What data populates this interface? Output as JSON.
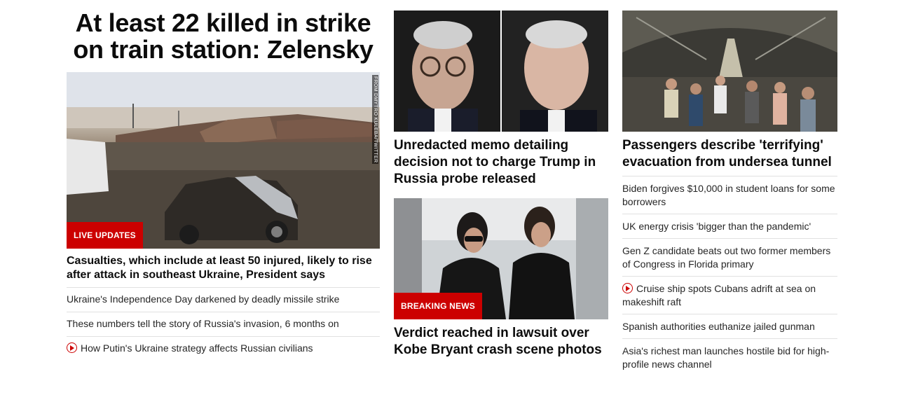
{
  "hero": {
    "title": "At least 22 killed in strike on train station: Zelensky",
    "photo_credit": "FROM DMYTRO KULEBA/TWITTER",
    "badge": "LIVE UPDATES",
    "caption": "Casualties, which include at least 50 injured, likely to rise after attack in southeast Ukraine, President says",
    "links": [
      {
        "text": "Ukraine's Independence Day darkened by deadly missile strike",
        "icon": "none"
      },
      {
        "text": "These numbers tell the story of Russia's invasion, 6 months on",
        "icon": "none"
      },
      {
        "text": "How Putin's Ukraine strategy affects Russian civilians",
        "icon": "play-icon"
      }
    ]
  },
  "middle": {
    "card1": {
      "title": "Unredacted memo detailing decision not to charge Trump in Russia probe released"
    },
    "card2": {
      "badge": "BREAKING NEWS",
      "title": "Verdict reached in lawsuit over Kobe Bryant crash scene photos"
    }
  },
  "right": {
    "card": {
      "title": "Passengers describe 'terrifying' evacuation from undersea tunnel"
    },
    "links": [
      {
        "text": "Biden forgives $10,000 in student loans for some borrowers",
        "icon": "none"
      },
      {
        "text": "UK energy crisis 'bigger than the pandemic'",
        "icon": "none"
      },
      {
        "text": "Gen Z candidate beats out two former members of Congress in Florida primary",
        "icon": "none"
      },
      {
        "text": "Cruise ship spots Cubans adrift at sea on makeshift raft",
        "icon": "play-icon"
      },
      {
        "text": "Spanish authorities euthanize jailed gunman",
        "icon": "none"
      },
      {
        "text": "Asia's richest man launches hostile bid for high-profile news channel",
        "icon": "none"
      }
    ]
  },
  "colors": {
    "accent": "#cc0000",
    "divider": "#e1e1e1",
    "text": "#262626"
  }
}
